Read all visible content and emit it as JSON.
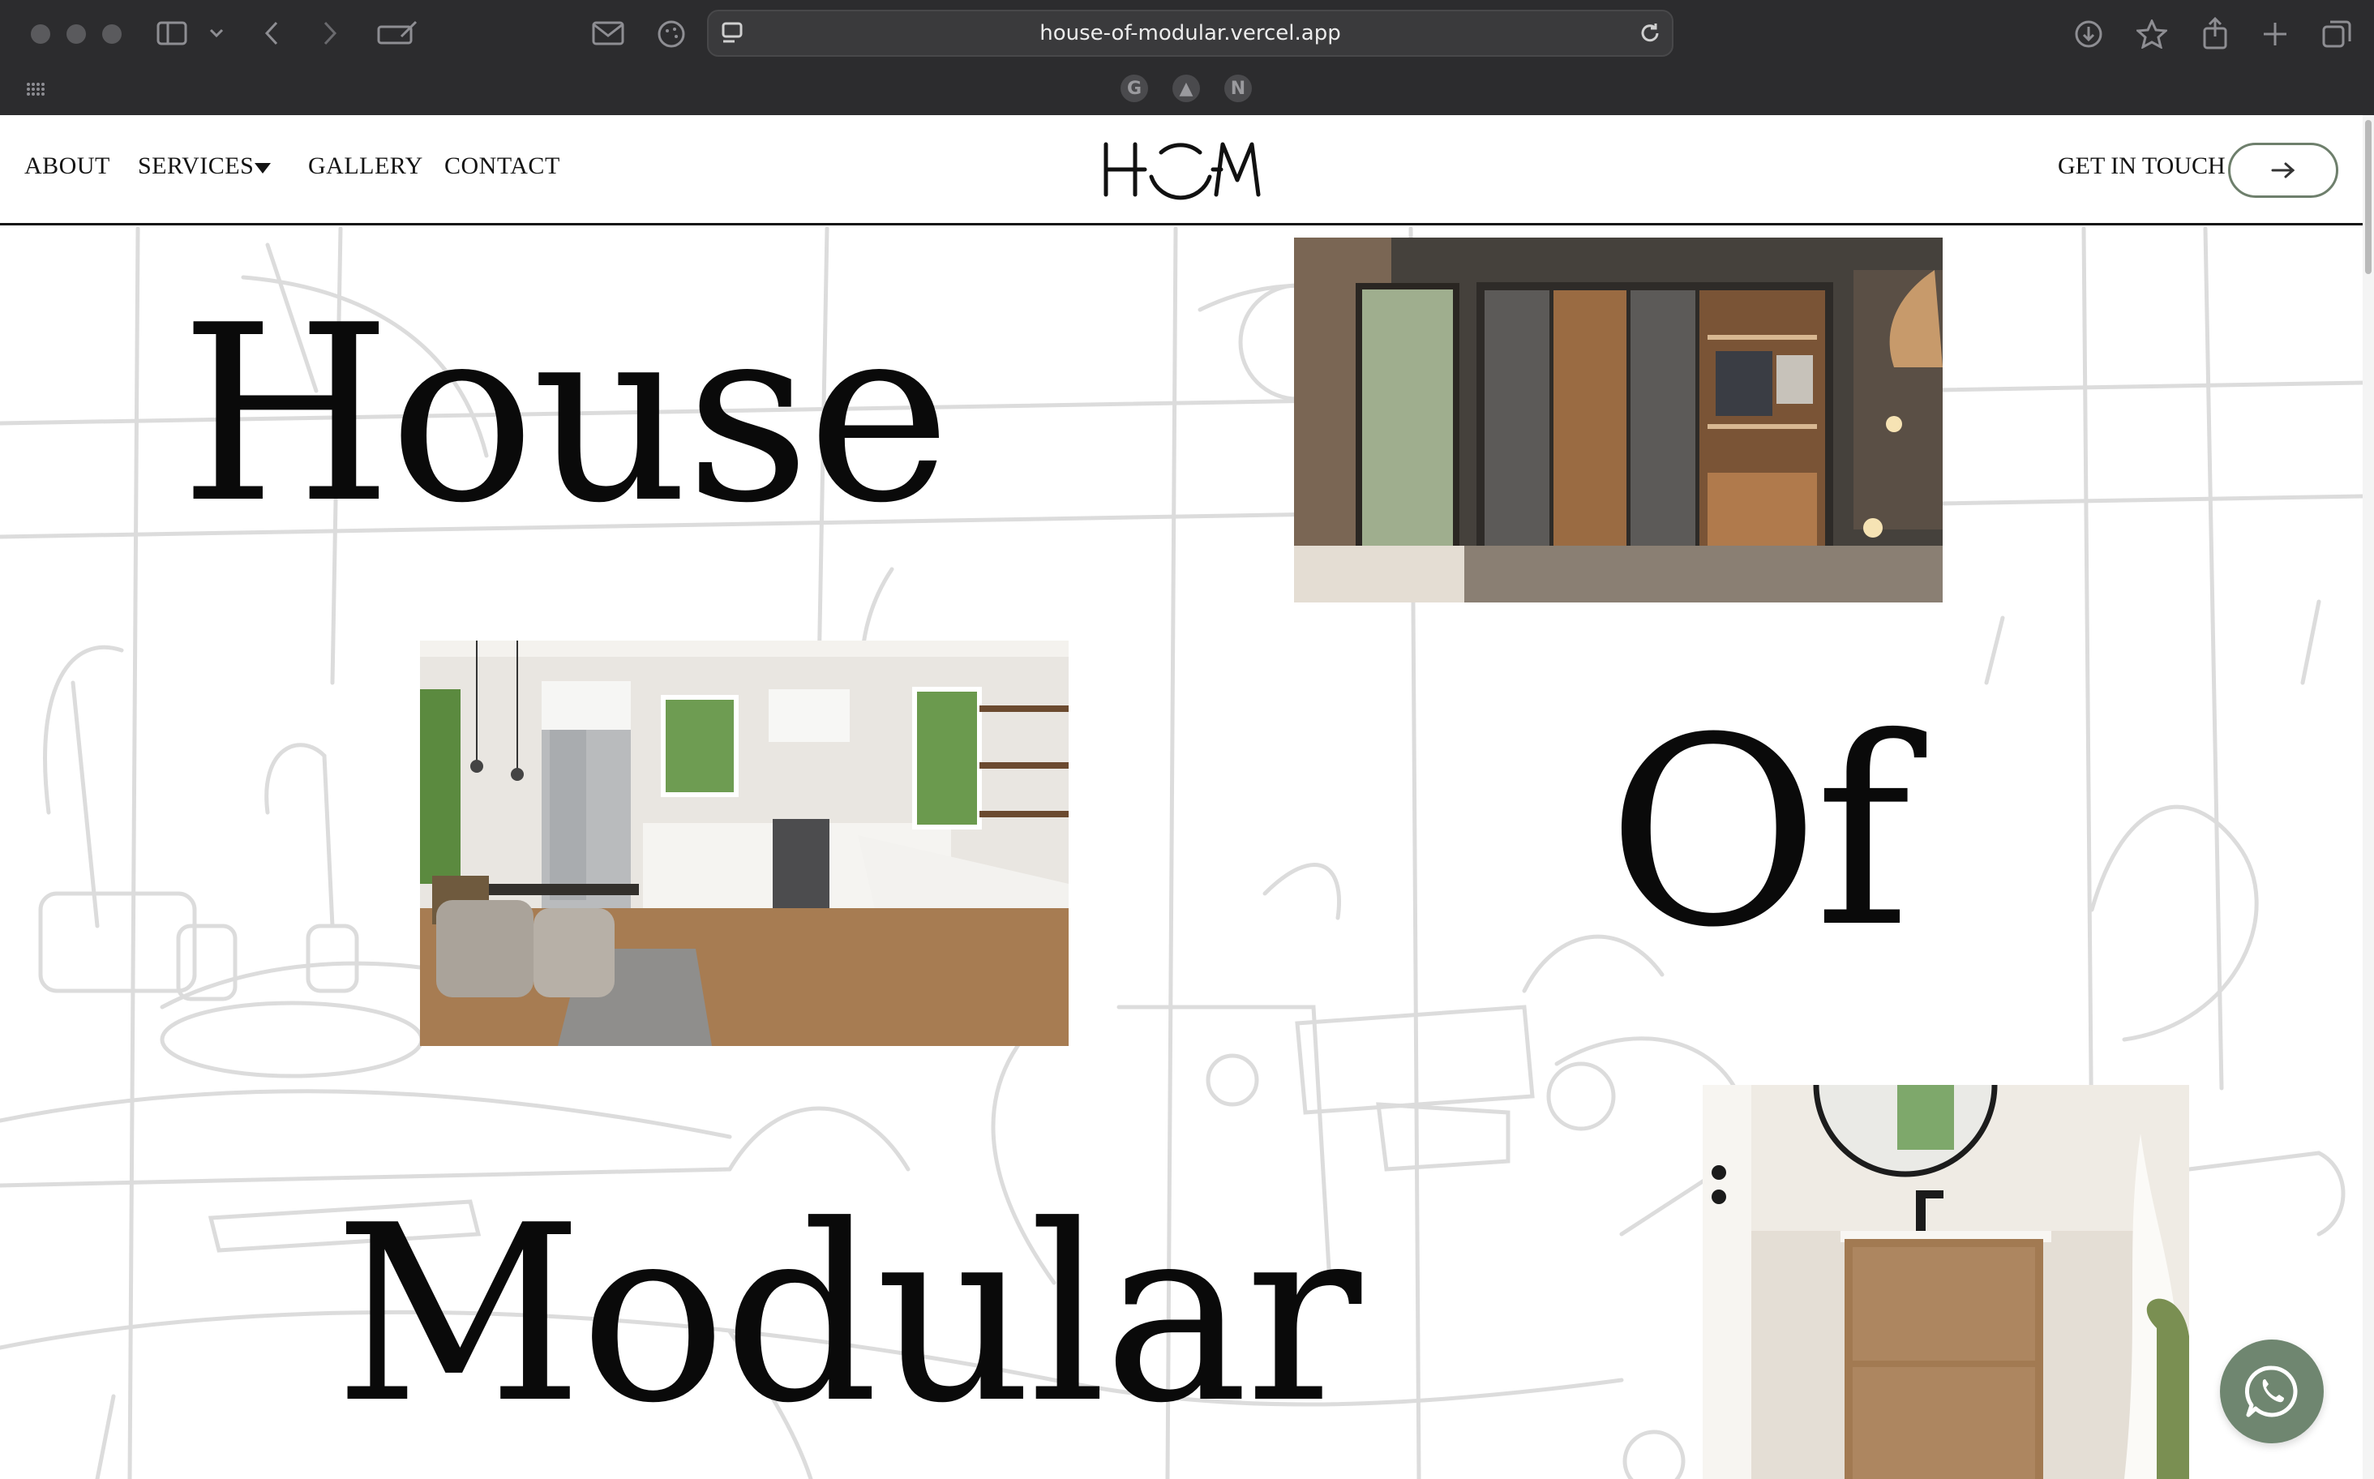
{
  "browser": {
    "url": "house-of-modular.vercel.app"
  },
  "nav": {
    "about": "ABOUT",
    "services": "SERVICES",
    "gallery": "GALLERY",
    "contact": "CONTACT",
    "get_in_touch": "GET IN TOUCH"
  },
  "hero": {
    "word1": "House",
    "word2": "Of",
    "word3": "Modular"
  },
  "images": {
    "wardrobe": "wardrobe-bedroom-photo",
    "kitchen": "kitchen-photo",
    "bathroom": "bathroom-vanity-photo"
  },
  "colors": {
    "accent_green": "#6f8670",
    "button_border": "#6e7f6c"
  }
}
